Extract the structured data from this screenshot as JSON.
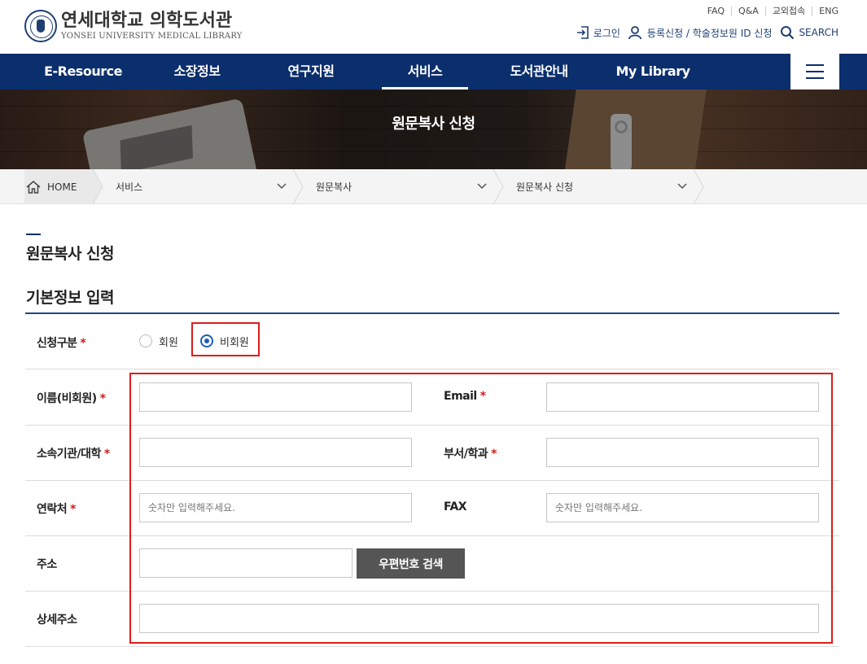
{
  "logo": {
    "korean": "연세대학교 의학도서관",
    "english": "YONSEI UNIVERSITY MEDICAL LIBRARY"
  },
  "util_links": [
    "FAQ",
    "Q&A",
    "교외접속",
    "ENG"
  ],
  "member_links": {
    "login": "로그인",
    "register": "등록신청 / 학술정보원 ID 신청",
    "search": "SEARCH"
  },
  "nav": {
    "items": [
      "E-Resource",
      "소장정보",
      "연구지원",
      "서비스",
      "도서관안내",
      "My Library"
    ],
    "active_index": 3
  },
  "banner": {
    "title": "원문복사 신청"
  },
  "breadcrumb": {
    "home": "HOME",
    "level1": "서비스",
    "level2": "원문복사",
    "level3": "원문복사 신청"
  },
  "page": {
    "title": "원문복사 신청",
    "section_title": "기본정보 입력"
  },
  "form": {
    "request_type": {
      "label": "신청구분",
      "required_mark": "*",
      "options": [
        "회원",
        "비회원"
      ],
      "selected": "비회원"
    },
    "name": {
      "label": "이름(비회원)",
      "required_mark": "*",
      "value": ""
    },
    "email": {
      "label": "Email",
      "required_mark": "*",
      "value": ""
    },
    "affiliation": {
      "label": "소속기관/대학",
      "required_mark": "*",
      "value": ""
    },
    "department": {
      "label": "부서/학과",
      "required_mark": "*",
      "value": ""
    },
    "phone": {
      "label": "연락처",
      "required_mark": "*",
      "placeholder": "숫자만 입력해주세요.",
      "value": ""
    },
    "fax": {
      "label": "FAX",
      "placeholder": "숫자만 입력해주세요.",
      "value": ""
    },
    "address": {
      "label": "주소",
      "value": "",
      "zip_button": "우편번호 검색"
    },
    "address_detail": {
      "label": "상세주소",
      "value": ""
    }
  },
  "colors": {
    "nav_bg": "#0b2e6c",
    "highlight_border": "#dd1c1c",
    "required": "#d31b1b",
    "radio_selected": "#1f5eb5"
  }
}
